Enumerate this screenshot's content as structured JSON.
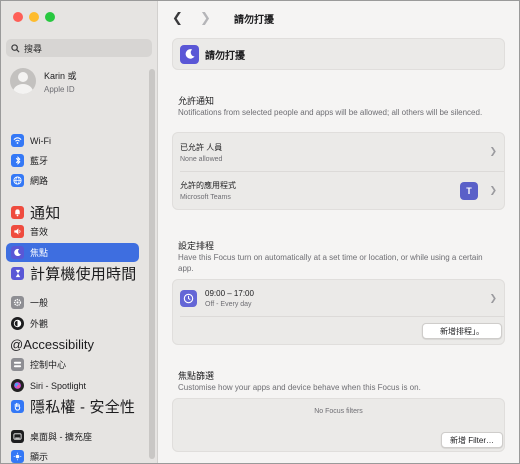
{
  "search": {
    "placeholder": "搜尋"
  },
  "account": {
    "name": "Karin 或",
    "subtitle": "Apple ID"
  },
  "sidebar": {
    "items": [
      {
        "label": "Wi-Fi",
        "icon": "wifi-icon",
        "color": "#3478f6"
      },
      {
        "label": "藍牙",
        "icon": "bluetooth-icon",
        "color": "#3478f6"
      },
      {
        "label": "網路",
        "icon": "globe-icon",
        "color": "#3478f6"
      },
      {
        "label": "通知",
        "icon": "bell-icon",
        "color": "#ef4b3e"
      },
      {
        "label": "音效",
        "icon": "speaker-icon",
        "color": "#ef4b3e"
      },
      {
        "label": "焦點",
        "icon": "moon-icon",
        "color": "#5a57d6"
      },
      {
        "label": "計算機使用時間",
        "icon": "hourglass-icon",
        "color": "#5a57d6"
      },
      {
        "label": "一般",
        "icon": "gear-icon",
        "color": "#8e8e93"
      },
      {
        "label": "外觀",
        "icon": "appearance-icon",
        "color": "#1d1d1f"
      },
      {
        "label": "@Accessibility",
        "icon": "",
        "color": ""
      },
      {
        "label": "控制中心",
        "icon": "control-center-icon",
        "color": "#8e8e93"
      },
      {
        "label": "Siri - Spotlight",
        "icon": "siri-icon",
        "color": "#222222"
      },
      {
        "label": "隱私權 - 安全性",
        "icon": "hand-icon",
        "color": "#3478f6"
      },
      {
        "label": "桌面與 - 擴充座",
        "icon": "dock-icon",
        "color": "#1d1d1f"
      },
      {
        "label": "顯示",
        "icon": "display-icon",
        "color": "#3478f6"
      }
    ]
  },
  "main": {
    "window_title": "請勿打擾",
    "focus_title": "請勿打擾",
    "allowed": {
      "title": "允許通知",
      "description": "Notifications from selected people and apps will be allowed; all others will be silenced.",
      "people_title": "已允許 人員",
      "people_sub": "None allowed",
      "apps_title": "允許的應用程式",
      "apps_sub": "Microsoft Teams",
      "teams_glyph": "T"
    },
    "schedule": {
      "title": "設定排程",
      "description": "Have this Focus turn on automatically at a set time or location, or while using a certain app.",
      "time": "09:00 – 17:00",
      "days": "Off - Every day",
      "add_button": "新增排程」。"
    },
    "filters": {
      "title": "焦點篩選",
      "description": "Customise how your apps and device behave when this Focus is on.",
      "empty": "No Focus filters",
      "add_button": "新增 Filter…"
    }
  },
  "colors": {
    "accent": "#3e6ee0",
    "focus_purple": "#5a57d6"
  }
}
